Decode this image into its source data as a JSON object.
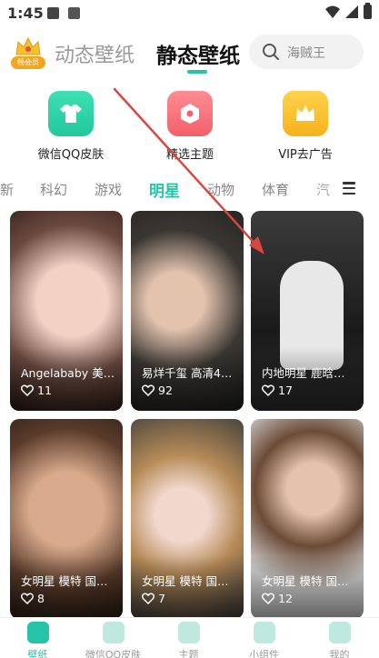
{
  "status_bar": {
    "time": "1:45"
  },
  "top_tabs": {
    "vip_badge": "畅会员",
    "dynamic": "动态壁纸",
    "static": "静态壁纸"
  },
  "search": {
    "placeholder": "海贼王",
    "icon": "search-icon"
  },
  "quick_actions": [
    {
      "label": "微信QQ皮肤",
      "icon": "tshirt-icon",
      "color": "#2bd0a5"
    },
    {
      "label": "精选主题",
      "icon": "theme-icon",
      "color": "#f5666f"
    },
    {
      "label": "VIP去广告",
      "icon": "crown-icon",
      "color": "#f8b61f"
    }
  ],
  "categories": [
    "新",
    "科幻",
    "游戏",
    "明星",
    "动物",
    "体育",
    "汽"
  ],
  "active_category": "明星",
  "cards": [
    {
      "title": "Angelababy 美…",
      "likes": "11"
    },
    {
      "title": "易烊千玺 高清4…",
      "likes": "92"
    },
    {
      "title": "内地明星 鹿晗…",
      "likes": "17"
    },
    {
      "title": "女明星 模特 国…",
      "likes": "8"
    },
    {
      "title": "女明星 模特 国…",
      "likes": "7"
    },
    {
      "title": "女明星 模特 国…",
      "likes": "12"
    }
  ],
  "bottom_nav": [
    {
      "label": "壁纸",
      "icon": "wallpaper-icon",
      "active": true
    },
    {
      "label": "微信QQ皮肤",
      "icon": "tshirt-icon",
      "active": false
    },
    {
      "label": "主题",
      "icon": "theme-icon",
      "active": false
    },
    {
      "label": "小组件",
      "icon": "widget-icon",
      "active": false
    },
    {
      "label": "我的",
      "icon": "profile-icon",
      "active": false
    }
  ],
  "colors": {
    "accent": "#27c3a7",
    "annotation_arrow": "#d8473d"
  }
}
